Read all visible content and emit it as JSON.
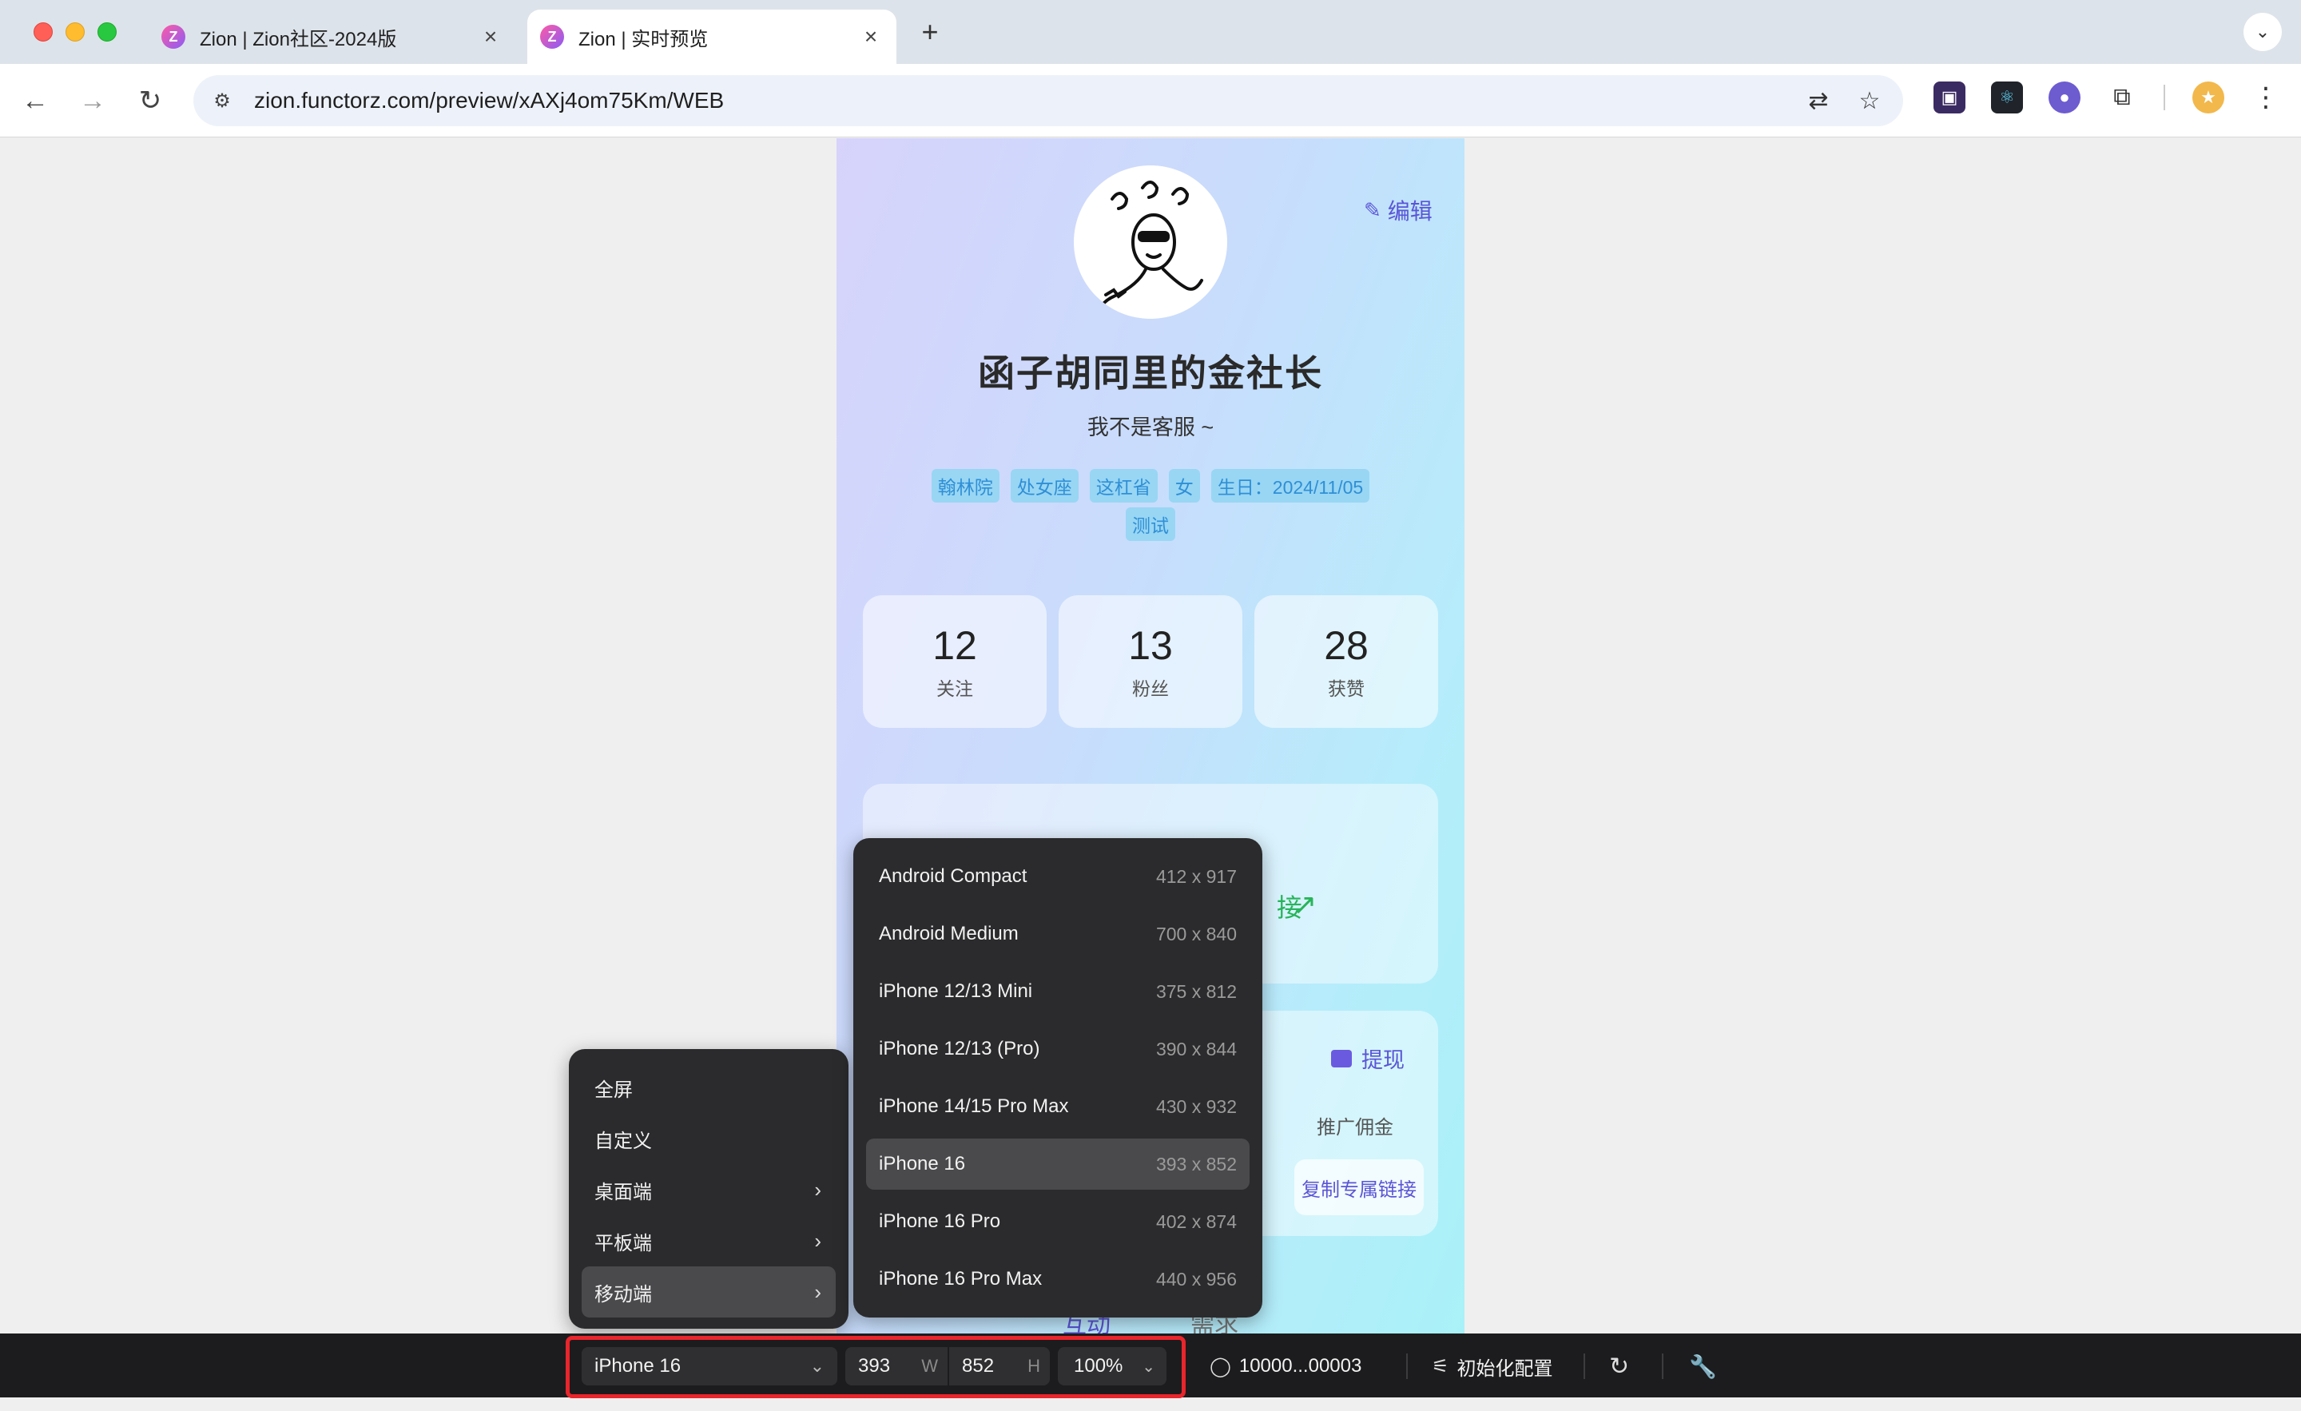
{
  "browser": {
    "tabs": [
      {
        "title": "Zion | Zion社区-2024版",
        "active": false
      },
      {
        "title": "Zion | 实时预览",
        "active": true
      }
    ],
    "url": "zion.functorz.com/preview/xAXj4om75Km/WEB"
  },
  "profile": {
    "edit_label": "编辑",
    "name": "函子胡同里的金社长",
    "bio": "我不是客服 ~",
    "tags_row1": [
      "翰林院",
      "处女座",
      "这杠省",
      "女",
      "生日：2024/11/05"
    ],
    "tags_row2": [
      "测试"
    ],
    "stats": [
      {
        "value": "12",
        "label": "关注"
      },
      {
        "value": "13",
        "label": "粉丝"
      },
      {
        "value": "28",
        "label": "获赞"
      }
    ],
    "promo_partial_text": "接",
    "withdraw_label": "提现",
    "commission_label": "推广佣金",
    "copy_link_label": "复制专属链接",
    "bottom_tabs": [
      "互动",
      "需求"
    ]
  },
  "device_menu": {
    "items": [
      {
        "label": "全屏",
        "has_submenu": false
      },
      {
        "label": "自定义",
        "has_submenu": false
      },
      {
        "label": "桌面端",
        "has_submenu": true
      },
      {
        "label": "平板端",
        "has_submenu": true
      },
      {
        "label": "移动端",
        "has_submenu": true,
        "active": true
      }
    ],
    "mobile_devices": [
      {
        "name": "Android Compact",
        "size": "412 x 917"
      },
      {
        "name": "Android Medium",
        "size": "700 x 840"
      },
      {
        "name": "iPhone 12/13 Mini",
        "size": "375 x 812"
      },
      {
        "name": "iPhone 12/13 (Pro)",
        "size": "390 x 844"
      },
      {
        "name": "iPhone 14/15 Pro Max",
        "size": "430 x 932"
      },
      {
        "name": "iPhone 16",
        "size": "393 x 852",
        "active": true
      },
      {
        "name": "iPhone 16 Pro",
        "size": "402 x 874"
      },
      {
        "name": "iPhone 16 Pro Max",
        "size": "440 x 956"
      }
    ]
  },
  "preview_bar": {
    "device": "iPhone 16",
    "width": "393",
    "width_unit": "W",
    "height": "852",
    "height_unit": "H",
    "zoom": "100%",
    "user": "10000...00003",
    "init_config": "初始化配置"
  },
  "colors": {
    "accent": "#5a55d6",
    "tag_bg": "#98d6f4",
    "tag_text": "#2f8fd6",
    "highlight": "#e8262c",
    "menu_bg": "#2b2b2d"
  }
}
